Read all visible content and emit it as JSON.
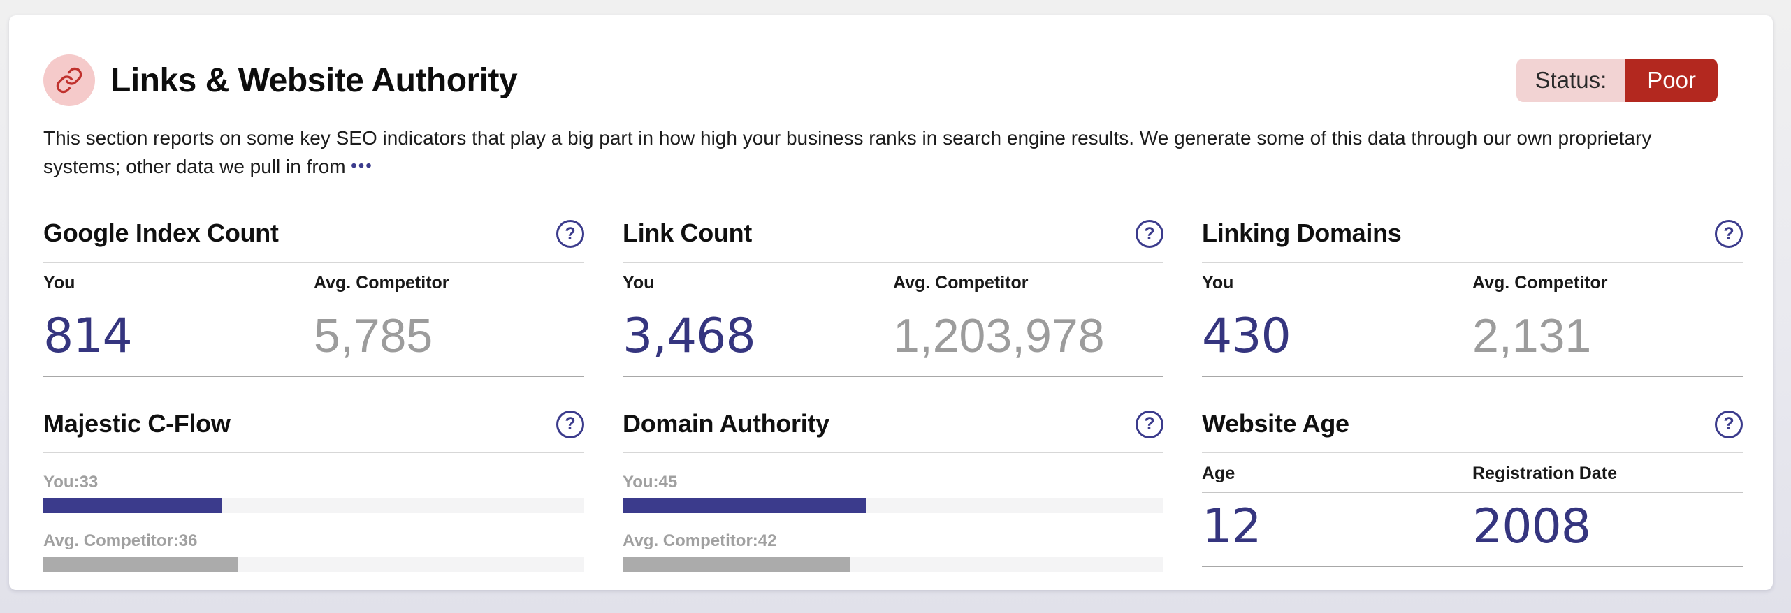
{
  "header": {
    "icon": "link-icon",
    "title": "Links & Website Authority",
    "status_label": "Status:",
    "status_value": "Poor",
    "description": "This section reports on some key SEO indicators that play a big part in how high your business ranks in search engine results. We generate some of this data through our own proprietary systems; other data we pull in from",
    "more_ellipsis": "•••"
  },
  "help_icon": "?",
  "colors": {
    "accent_indigo": "#3b3b8c",
    "value_indigo": "#35357f",
    "muted_value_gray": "#9c9c9c",
    "status_red": "#b3281f",
    "status_pink": "#f2d3d3",
    "icon_circle_pink": "#f5caca",
    "icon_link_red": "#c0312d",
    "bar_gray": "#ababab",
    "bar_track": "#f4f4f5"
  },
  "cards": [
    {
      "title": "Google Index Count",
      "columns": [
        "You",
        "Avg. Competitor"
      ],
      "values": [
        "814",
        "5,785"
      ]
    },
    {
      "title": "Link Count",
      "columns": [
        "You",
        "Avg. Competitor"
      ],
      "values": [
        "3,468",
        "1,203,978"
      ]
    },
    {
      "title": "Linking Domains",
      "columns": [
        "You",
        "Avg. Competitor"
      ],
      "values": [
        "430",
        "2,131"
      ]
    },
    {
      "title": "Majestic C-Flow",
      "bars": [
        {
          "label": "You:33",
          "value": 33
        },
        {
          "label": "Avg. Competitor:36",
          "value": 36
        }
      ]
    },
    {
      "title": "Domain Authority",
      "bars": [
        {
          "label": "You:45",
          "value": 45
        },
        {
          "label": "Avg. Competitor:42",
          "value": 42
        }
      ]
    },
    {
      "title": "Website Age",
      "columns": [
        "Age",
        "Registration Date"
      ],
      "values": [
        "12",
        "2008"
      ]
    }
  ]
}
